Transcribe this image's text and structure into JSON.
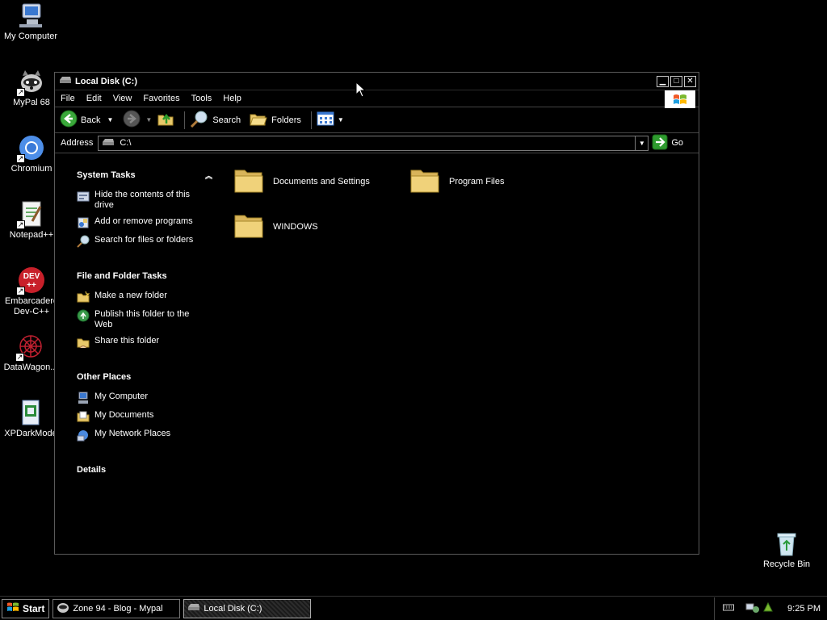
{
  "desktop": {
    "icons": [
      {
        "label": "My Computer"
      },
      {
        "label": "MyPal 68"
      },
      {
        "label": "Chromium"
      },
      {
        "label": "Notepad++"
      },
      {
        "label": "Embarcadero Dev-C++",
        "line1": "Embarcadero",
        "line2": "Dev-C++"
      },
      {
        "label": "DataWagon..."
      },
      {
        "label": "XPDarkMode"
      },
      {
        "label": "Recycle Bin"
      }
    ]
  },
  "window": {
    "title": "Local Disk (C:)",
    "menu": [
      "File",
      "Edit",
      "View",
      "Favorites",
      "Tools",
      "Help"
    ],
    "toolbar": {
      "back": "Back",
      "search": "Search",
      "folders": "Folders"
    },
    "address": {
      "label": "Address",
      "value": "C:\\",
      "go": "Go"
    },
    "panels": {
      "system_tasks": {
        "title": "System Tasks",
        "items": [
          "Hide the contents of this drive",
          "Add or remove programs",
          "Search for files or folders"
        ]
      },
      "file_folder_tasks": {
        "title": "File and Folder Tasks",
        "items": [
          "Make a new folder",
          "Publish this folder to the Web",
          "Share this folder"
        ]
      },
      "other_places": {
        "title": "Other Places",
        "items": [
          "My Computer",
          "My Documents",
          "My Network Places"
        ]
      },
      "details": {
        "title": "Details"
      }
    },
    "files": [
      "Documents and Settings",
      "Program Files",
      "WINDOWS"
    ]
  },
  "taskbar": {
    "start": "Start",
    "tasks": [
      "Zone 94 - Blog - Mypal",
      "Local Disk (C:)"
    ],
    "clock": "9:25 PM"
  },
  "colors": {
    "folder": "#e8c86a",
    "go_green": "#2e9b2e",
    "back_green": "#3aa83a"
  }
}
